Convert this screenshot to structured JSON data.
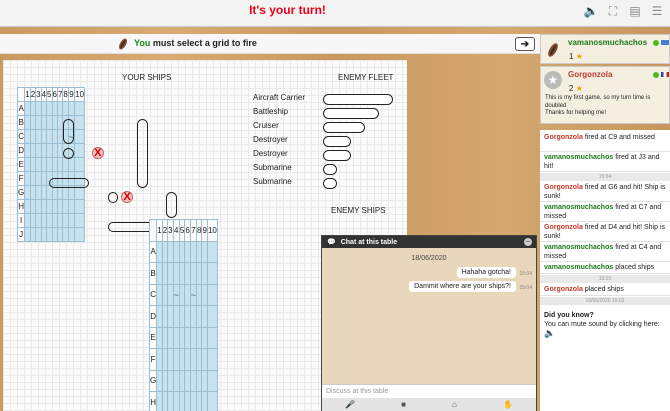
{
  "header": {
    "turn_title": "It's your turn!"
  },
  "action_bar": {
    "you": "You",
    "instruction": "must select a grid to fire"
  },
  "own_board": {
    "label": "YOUR SHIPS",
    "columns": [
      "1",
      "2",
      "3",
      "4",
      "5",
      "6",
      "7",
      "8",
      "9",
      "10"
    ],
    "rows": [
      "A",
      "B",
      "C",
      "D",
      "E",
      "F",
      "G",
      "H",
      "I",
      "J"
    ],
    "miss_marker": "~",
    "hit_marker": "X"
  },
  "enemy_fleet": {
    "label": "ENEMY FLEET",
    "ships": [
      {
        "name": "Aircraft Carrier",
        "size": 5
      },
      {
        "name": "Battleship",
        "size": 4
      },
      {
        "name": "Cruiser",
        "size": 3
      },
      {
        "name": "Destroyer",
        "size": 2
      },
      {
        "name": "Destroyer",
        "size": 2
      },
      {
        "name": "Submarine",
        "size": 1
      },
      {
        "name": "Submarine",
        "size": 1
      }
    ]
  },
  "enemy_board": {
    "label": "ENEMY SHIPS",
    "columns": [
      "1",
      "2",
      "3",
      "4",
      "5",
      "6",
      "7",
      "8",
      "9",
      "10"
    ],
    "rows": [
      "A",
      "B",
      "C",
      "D",
      "E",
      "F",
      "G",
      "H"
    ],
    "miss_marker": "~"
  },
  "chat": {
    "title": "Chat at this table",
    "date": "18/06/2020",
    "messages": [
      {
        "text": "Hahaha gotcha!",
        "time": "15:04"
      },
      {
        "text": "Dammit where are your ships?!",
        "time": "15:04"
      }
    ],
    "input_placeholder": "Discuss at this table"
  },
  "players": [
    {
      "name": "vamanosmuchachos",
      "score": "1",
      "star": "★",
      "color": "#1a7a1a"
    },
    {
      "name": "Gorgonzola",
      "score": "2",
      "star": "★",
      "color": "#c0392b",
      "note_line1": "This is my first game, so my turn time is doubled",
      "note_line2": "Thanks for helping me!"
    }
  ],
  "log": {
    "entries": [
      {
        "player": "Gorgonzola",
        "text": "fired at C9 and missed"
      },
      {
        "player": "vamanosmuchachos",
        "text": "fired at J3 and hit!"
      },
      {
        "separator": "15:04"
      },
      {
        "player": "Gorgonzola",
        "text": "fired at G6 and hit! Ship is sunk!"
      },
      {
        "player": "vamanosmuchachos",
        "text": "fired at C7 and missed"
      },
      {
        "player": "Gorgonzola",
        "text": "fired at D4 and hit! Ship is sunk!"
      },
      {
        "player": "vamanosmuchachos",
        "text": "fired at C4 and missed"
      },
      {
        "player": "vamanosmuchachos",
        "text": "placed ships"
      },
      {
        "separator": "15:03"
      },
      {
        "player": "Gorgonzola",
        "text": "placed ships"
      },
      {
        "separator": "18/06/2020 15:02"
      }
    ],
    "tip_title": "Did you know?",
    "tip_text": "You can mute sound by clicking here:"
  },
  "colors": {
    "turn_red": "#e8001c",
    "you_green": "#1a8a1a",
    "cell_blue": "#c5e2ee"
  }
}
